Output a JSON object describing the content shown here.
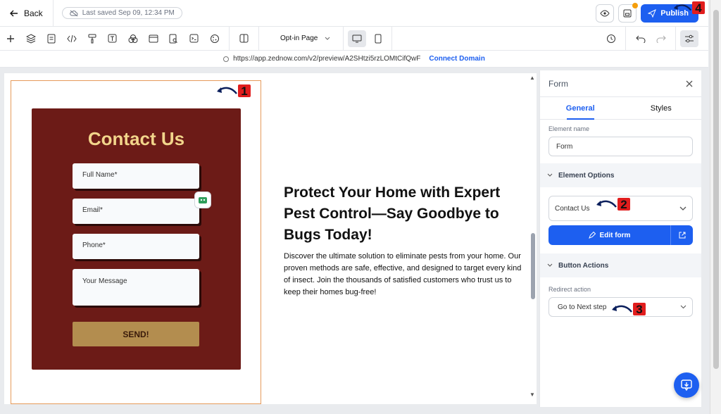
{
  "header": {
    "back_label": "Back",
    "saved_text": "Last saved Sep 09, 12:34 PM",
    "publish_label": "Publish"
  },
  "toolbar": {
    "page_type": "Opt-in Page"
  },
  "urlbar": {
    "url": "https://app.zednow.com/v2/preview/A2SHtzi5rzLOMtCifQwF",
    "connect_label": "Connect Domain"
  },
  "canvas": {
    "form": {
      "title": "Contact Us",
      "fields": [
        {
          "placeholder": "Full Name*"
        },
        {
          "placeholder": "Email*"
        },
        {
          "placeholder": "Phone*"
        },
        {
          "placeholder": "Your Message"
        }
      ],
      "submit_label": "SEND!"
    },
    "headline": "Protect Your Home with Expert Pest Control—Say Goodbye to Bugs Today!",
    "paragraph": "Discover the ultimate solution to eliminate pests from your home. Our proven methods are safe, effective, and designed to target every kind of insect. Join the thousands of satisfied customers who trust us to keep their homes bug-free!"
  },
  "panel": {
    "title": "Form",
    "tabs": [
      {
        "label": "General",
        "active": true
      },
      {
        "label": "Styles",
        "active": false
      }
    ],
    "element_name_label": "Element name",
    "element_name_value": "Form",
    "element_options_title": "Element Options",
    "form_select_value": "Contact Us",
    "edit_form_label": "Edit form",
    "button_actions_title": "Button Actions",
    "redirect_label": "Redirect action",
    "redirect_value": "Go to Next step"
  },
  "annotations": [
    "1",
    "2",
    "3",
    "4"
  ],
  "colors": {
    "accent": "#1d5ff0",
    "form_bg": "#6c1b17",
    "form_title": "#f2d58b",
    "send_button": "#b38d4f",
    "annotation": "#e11d1d"
  }
}
